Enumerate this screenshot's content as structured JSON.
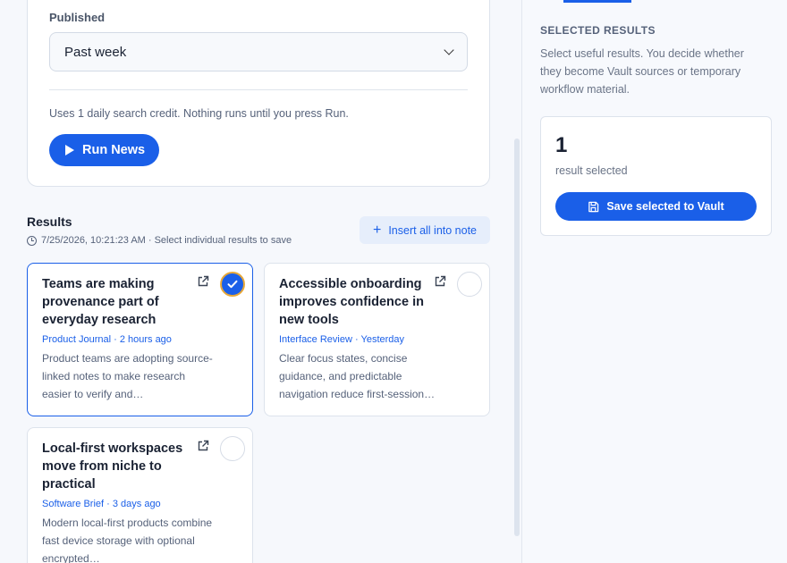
{
  "filters": {
    "published_label": "Published",
    "published_value": "Past week",
    "credit_note": "Uses 1 daily search credit. Nothing runs until you press Run.",
    "run_label": "Run News"
  },
  "results": {
    "title": "Results",
    "meta": "7/25/2026, 10:21:23 AM · Select individual results to save",
    "insert_label": "Insert all into note",
    "cards": [
      {
        "title": "Teams are making provenance part of everyday research",
        "source": "Product Journal · 2 hours ago",
        "excerpt": "Product teams are adopting source-linked notes to make research easier to verify and…",
        "selected": true
      },
      {
        "title": "Accessible onboarding improves confidence in new tools",
        "source": "Interface Review · Yesterday",
        "excerpt": "Clear focus states, concise guidance, and predictable navigation reduce first-session…",
        "selected": false
      },
      {
        "title": "Local-first workspaces move from niche to practical",
        "source": "Software Brief · 3 days ago",
        "excerpt": "Modern local-first products combine fast device storage with optional encrypted…",
        "selected": false
      }
    ]
  },
  "selected_panel": {
    "heading": "SELECTED RESULTS",
    "description": "Select useful results. You decide whether they become Vault sources or temporary workflow material.",
    "count": "1",
    "count_label": "result selected",
    "save_label": "Save selected to Vault"
  },
  "colors": {
    "accent": "#1a5fe8",
    "selected_ring": "#e8a838"
  },
  "icons": {
    "run": "play-icon",
    "time": "clock-icon",
    "insert": "plus-icon",
    "open": "external-link-icon",
    "select": "checkmark-icon",
    "save": "floppy-disk-icon",
    "dropdown": "chevron-down-icon"
  }
}
